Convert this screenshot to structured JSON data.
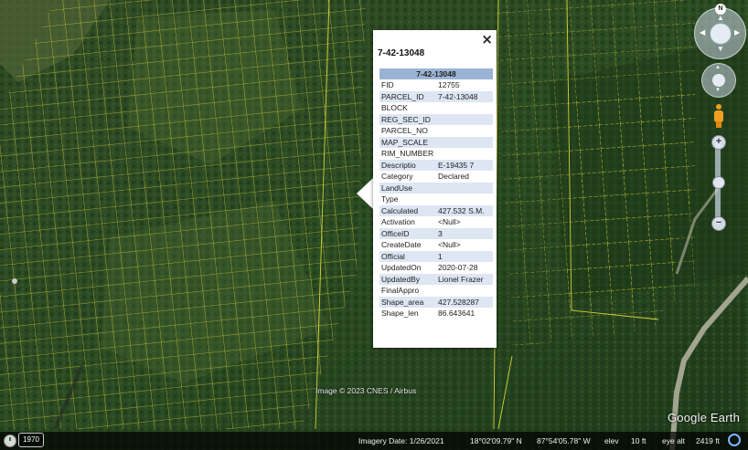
{
  "popup": {
    "close_icon": "×",
    "title": "7-42-13048",
    "table_header": "7-42-13048",
    "rows": [
      {
        "key": "FID",
        "value": "12755"
      },
      {
        "key": "PARCEL_ID",
        "value": "7-42-13048"
      },
      {
        "key": "BLOCK",
        "value": ""
      },
      {
        "key": "REG_SEC_ID",
        "value": ""
      },
      {
        "key": "PARCEL_NO",
        "value": ""
      },
      {
        "key": "MAP_SCALE",
        "value": ""
      },
      {
        "key": "RIM_NUMBER",
        "value": ""
      },
      {
        "key": "Descriptio",
        "value": "E-19435 7"
      },
      {
        "key": "Category",
        "value": "Declared"
      },
      {
        "key": "LandUse",
        "value": ""
      },
      {
        "key": "Type",
        "value": ""
      },
      {
        "key": "Calculated",
        "value": "427.532 S.M."
      },
      {
        "key": "Activation",
        "value": "<Null>"
      },
      {
        "key": "OfficeID",
        "value": "3"
      },
      {
        "key": "CreateDate",
        "value": "<Null>"
      },
      {
        "key": "Official",
        "value": "1"
      },
      {
        "key": "UpdatedOn",
        "value": "2020-07-28"
      },
      {
        "key": "UpdatedBy",
        "value": "Lionel Frazer"
      },
      {
        "key": "FinalAppro",
        "value": ""
      },
      {
        "key": "Shape_area",
        "value": "427.528287"
      },
      {
        "key": "Shape_len",
        "value": "86.643641"
      }
    ]
  },
  "map": {
    "copyright": "Image © 2023 CNES / Airbus",
    "logo": "Google Earth",
    "colors": {
      "parcel_lines": "#d8d23a",
      "table_header": "#9bb4d4",
      "row_alt": "#dde6f2"
    }
  },
  "status": {
    "year": "1970",
    "imagery_date": "Imagery Date: 1/26/2021",
    "latitude": "18°02'09.79\" N",
    "longitude": "87°54'05.78\" W",
    "elev": "elev",
    "elev_value": "10 ft",
    "eye_alt": "eye alt",
    "eye_alt_value": "2419 ft"
  },
  "nav": {
    "north_label": "N",
    "zoom_in": "+",
    "zoom_out": "−",
    "icons": [
      "compass-ring-icon",
      "look-joystick-icon",
      "pegman-icon",
      "zoom-slider-icon"
    ]
  }
}
